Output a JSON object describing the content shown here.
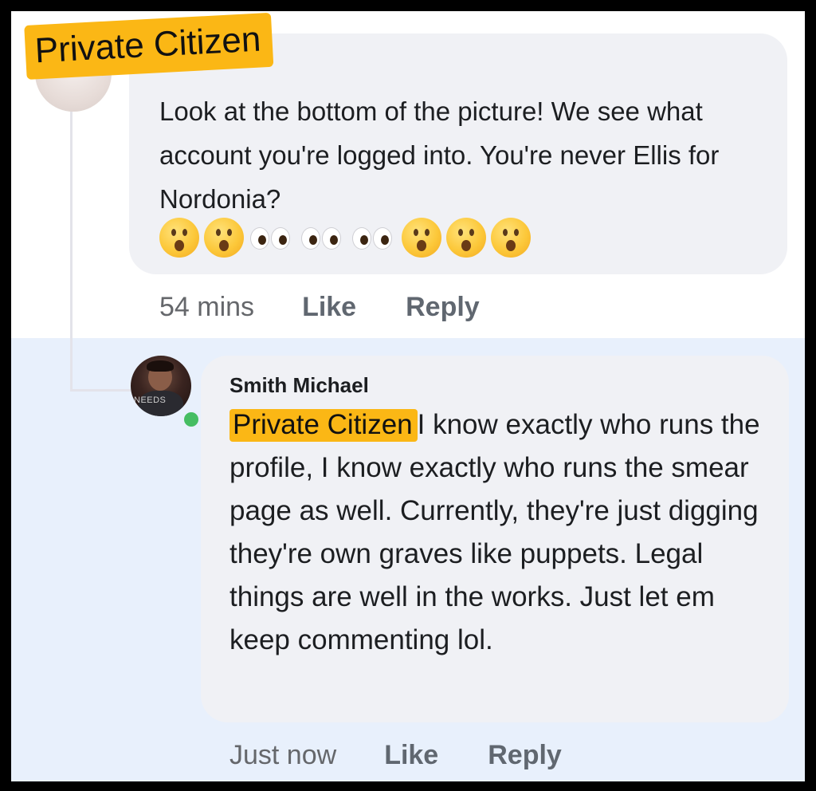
{
  "top_comment": {
    "label": "Private Citizen",
    "text": "Look at the bottom of the picture! We see what account you're logged into. You're never  Ellis for Nordonia?",
    "emojis": [
      "astonished-face",
      "astonished-face",
      "eyes",
      "eyes",
      "eyes",
      "astonished-face",
      "astonished-face",
      "astonished-face"
    ],
    "time": "54 mins",
    "like": "Like",
    "reply": "Reply"
  },
  "reply_comment": {
    "author": "Smith Michael",
    "avatar_badge": "NEEDS",
    "tag": "Private Citizen",
    "text": "I know exactly who runs the profile, I know exactly who runs the smear page as well. Currently, they're just digging they're own graves like puppets. Legal things are well in the works. Just let em keep commenting lol.",
    "time": "Just now",
    "like": "Like",
    "reply": "Reply"
  },
  "colors": {
    "highlight": "#fbb715",
    "bubble": "#f0f1f5",
    "reply_background": "#e8f0fc",
    "online": "#45bd62"
  }
}
